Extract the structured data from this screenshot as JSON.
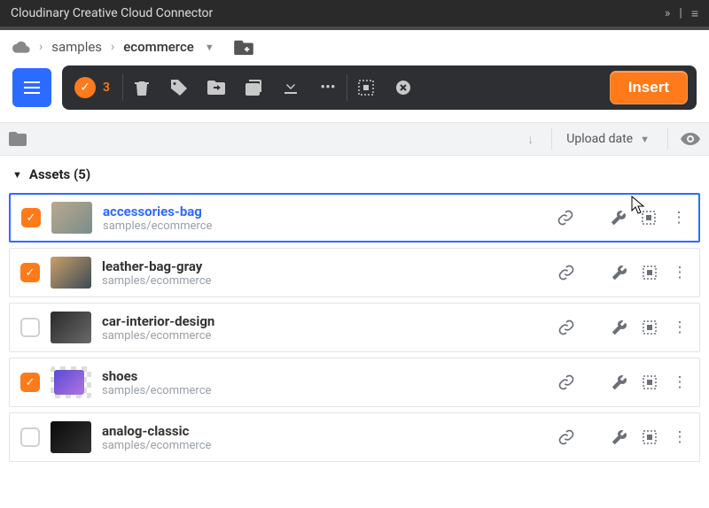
{
  "titlebar": {
    "title": "Cloudinary Creative Cloud Connector"
  },
  "breadcrumb": {
    "root_icon": "cloud-icon",
    "items": [
      "samples",
      "ecommerce"
    ]
  },
  "toolbar": {
    "selected_count": "3",
    "insert_label": "Insert"
  },
  "sort": {
    "label": "Upload date"
  },
  "section": {
    "title": "Assets (5)"
  },
  "assets": [
    {
      "name": "accessories-bag",
      "path": "samples/ecommerce",
      "checked": true,
      "highlight": true,
      "thumb": "t1"
    },
    {
      "name": "leather-bag-gray",
      "path": "samples/ecommerce",
      "checked": true,
      "highlight": false,
      "thumb": "t2"
    },
    {
      "name": "car-interior-design",
      "path": "samples/ecommerce",
      "checked": false,
      "highlight": false,
      "thumb": "t3"
    },
    {
      "name": "shoes",
      "path": "samples/ecommerce",
      "checked": true,
      "highlight": false,
      "thumb": "t4"
    },
    {
      "name": "analog-classic",
      "path": "samples/ecommerce",
      "checked": false,
      "highlight": false,
      "thumb": "t5"
    }
  ]
}
